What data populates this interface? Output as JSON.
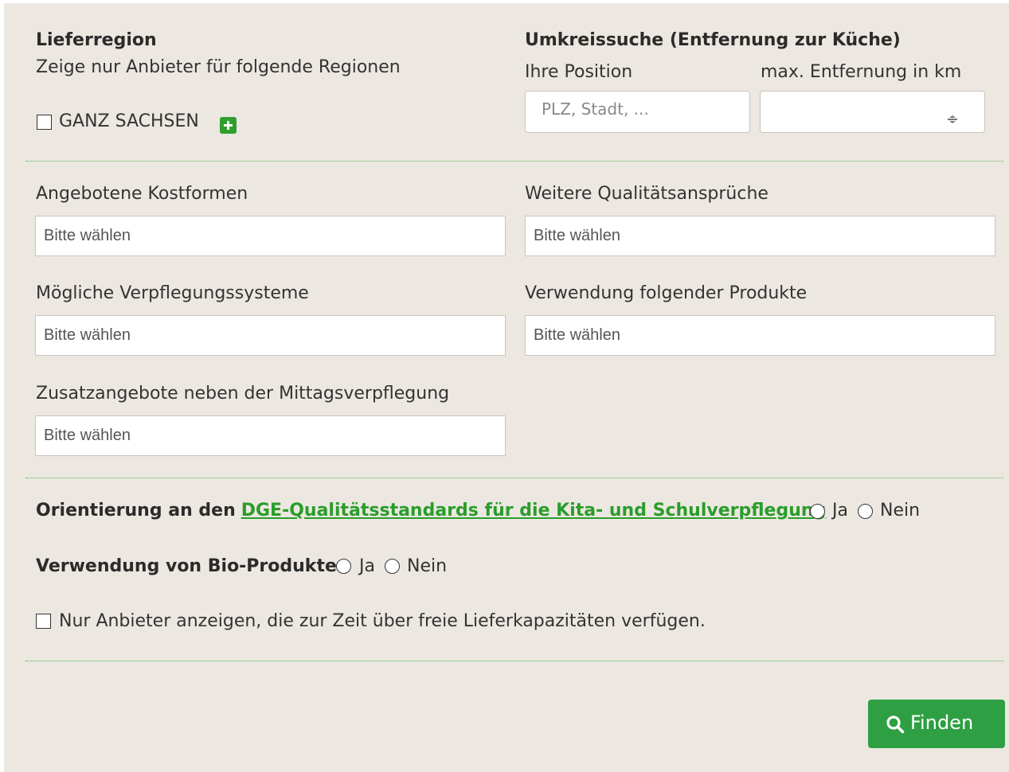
{
  "region": {
    "title": "Lieferregion",
    "subtitle": "Zeige nur Anbieter für folgende Regionen",
    "checkbox_label": "GANZ SACHSEN"
  },
  "radius": {
    "title": "Umkreissuche (Entfernung zur Küche)",
    "position_label": "Ihre Position",
    "position_placeholder": "PLZ, Stadt, ...",
    "distance_label": "max. Entfernung in km",
    "distance_value": ""
  },
  "filters": {
    "kostformen_label": "Angebotene Kostformen",
    "kostformen_placeholder": "Bitte wählen",
    "qualitaet_label": "Weitere Qualitätsansprüche",
    "qualitaet_placeholder": "Bitte wählen",
    "systeme_label": "Mögliche Verpflegungssysteme",
    "systeme_placeholder": "Bitte wählen",
    "produkte_label": "Verwendung folgender Produkte",
    "produkte_placeholder": "Bitte wählen",
    "zusatz_label": "Zusatzangebote neben der Mittagsverpflegung",
    "zusatz_placeholder": "Bitte wählen"
  },
  "dge": {
    "prefix": "Orientierung an den",
    "link": "DGE-Qualitätsstandards für die Kita- und Schulverpflegung",
    "yes": "Ja",
    "no": "Nein"
  },
  "bio": {
    "label": "Verwendung von Bio-Produkte",
    "yes": "Ja",
    "no": "Nein"
  },
  "capacity": {
    "label": "Nur Anbieter anzeigen, die zur Zeit über freie Lieferkapazitäten verfügen."
  },
  "search_button": {
    "label": "Finden"
  },
  "colors": {
    "accent": "#2ea043",
    "link": "#2a9d2a",
    "panel": "#ece8e1"
  }
}
